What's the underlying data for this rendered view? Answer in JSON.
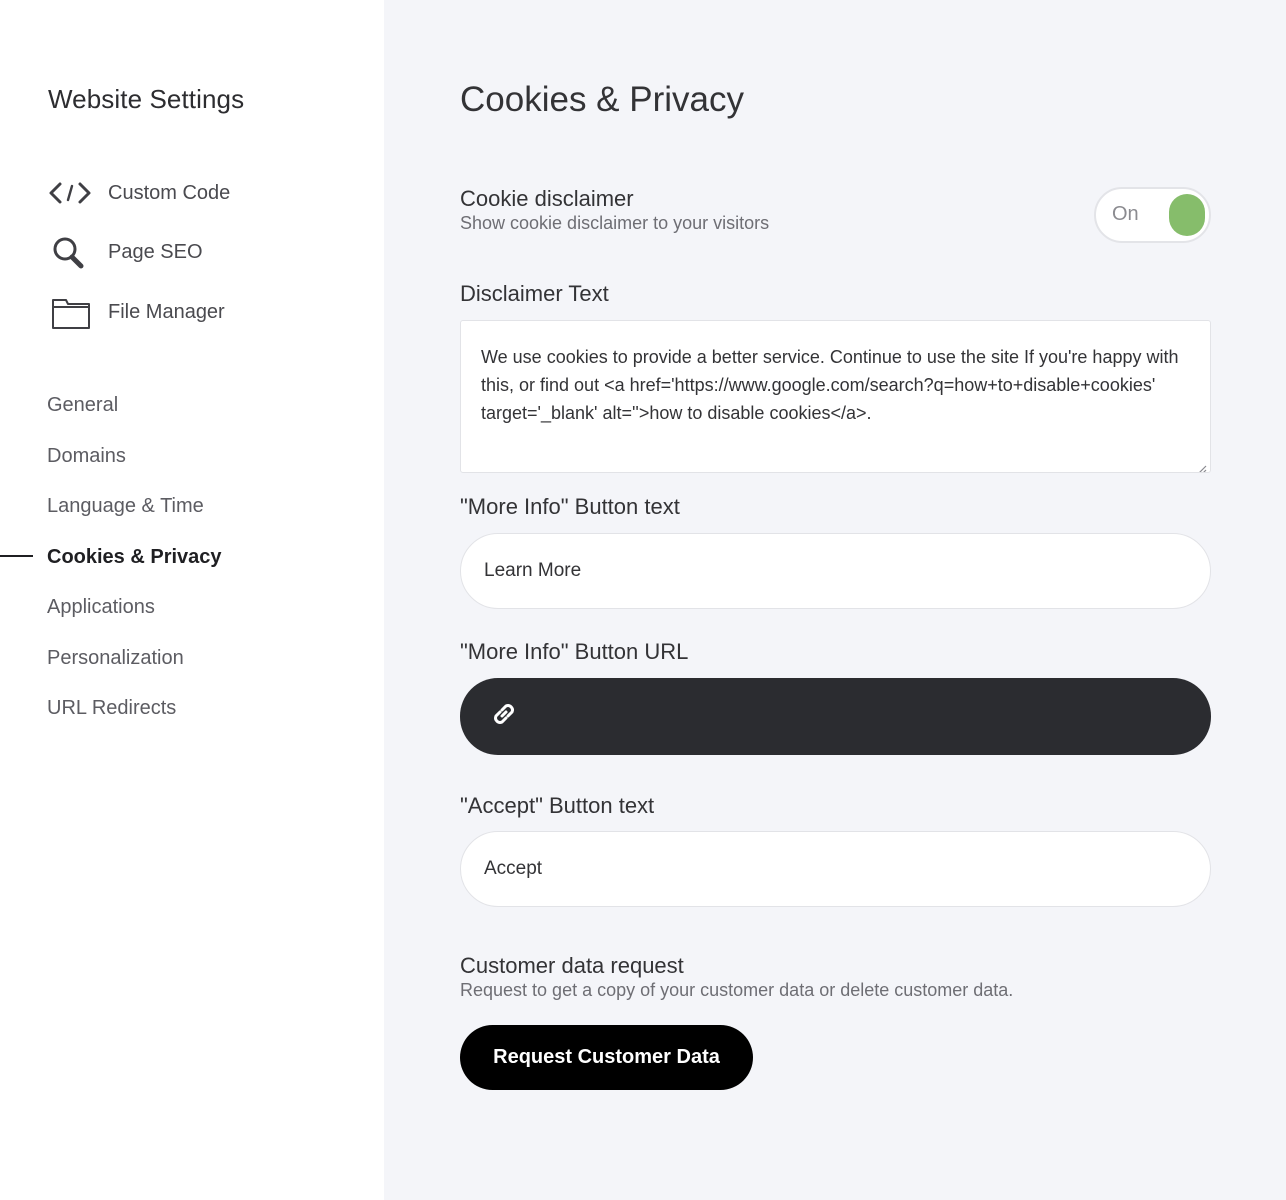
{
  "sidebar": {
    "title": "Website Settings",
    "tools": [
      {
        "label": "Custom Code",
        "icon": "code-icon"
      },
      {
        "label": "Page SEO",
        "icon": "search-icon"
      },
      {
        "label": "File Manager",
        "icon": "folder-icon"
      }
    ],
    "nav": [
      {
        "label": "General"
      },
      {
        "label": "Domains"
      },
      {
        "label": "Language & Time"
      },
      {
        "label": "Cookies & Privacy",
        "active": true
      },
      {
        "label": "Applications"
      },
      {
        "label": "Personalization"
      },
      {
        "label": "URL Redirects"
      }
    ]
  },
  "main": {
    "title": "Cookies & Privacy",
    "cookie_disclaimer": {
      "title": "Cookie disclaimer",
      "subtitle": "Show cookie disclaimer to your visitors",
      "toggle_label": "On",
      "toggle_color": "#86bd6b"
    },
    "disclaimer_text": {
      "label": "Disclaimer Text",
      "value": "We use cookies to provide a better service. Continue to use the site If you're happy with this, or find out <a href='https://www.google.com/search?q=how+to+disable+cookies' target='_blank' alt=''>how to disable cookies</a>."
    },
    "more_info_text": {
      "label": "\"More Info\" Button text",
      "value": "Learn More"
    },
    "more_info_url": {
      "label": "\"More Info\" Button URL",
      "icon": "link-icon",
      "value": ""
    },
    "accept_text": {
      "label": "\"Accept\" Button text",
      "value": "Accept"
    },
    "customer_data": {
      "title": "Customer data request",
      "subtitle": "Request to get a copy of your customer data or delete customer data.",
      "button_label": "Request Customer Data"
    }
  }
}
